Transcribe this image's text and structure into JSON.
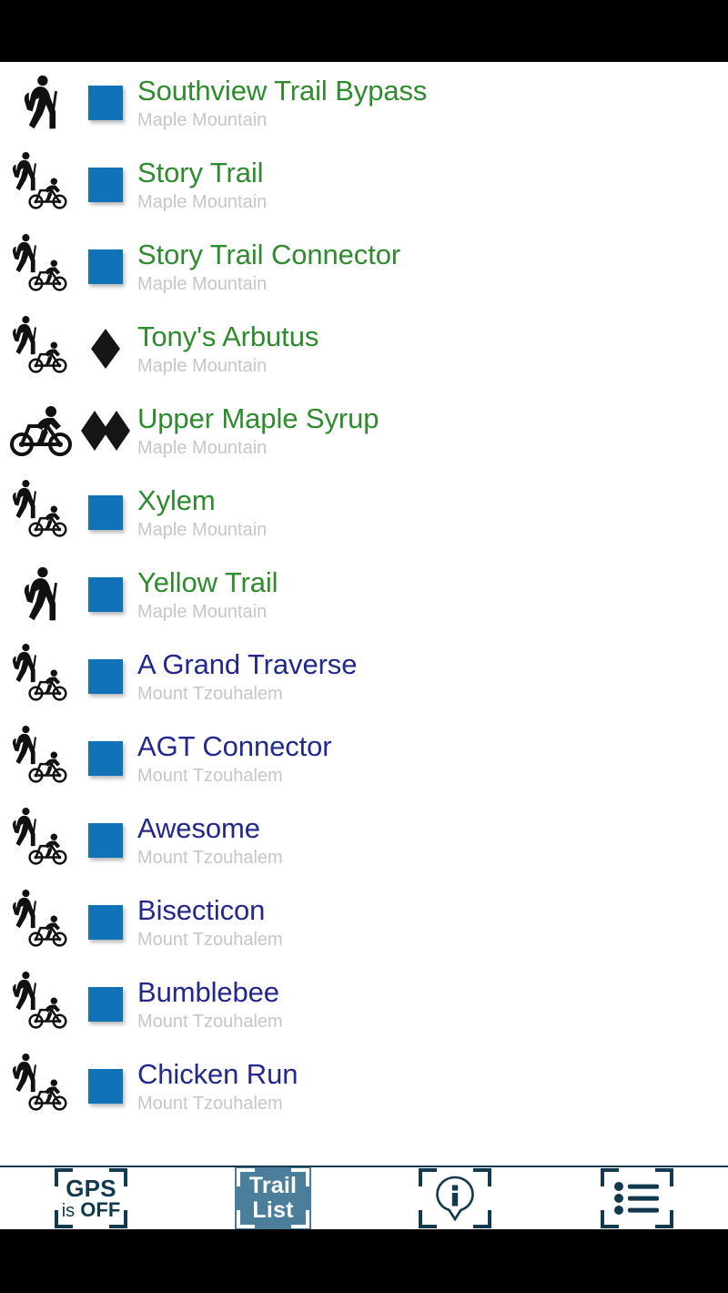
{
  "app": {
    "title": "Trail List"
  },
  "colors": {
    "title_green": "#2E8B2E",
    "title_navy": "#22288C",
    "area_gray": "#C3C7CB",
    "difficulty_blue": "#1272B8",
    "nav_selected_bg": "#4A7E9B",
    "nav_ink": "#12394E",
    "letterbox": "#000000"
  },
  "trails": [
    {
      "name": "Southview Trail Bypass",
      "area": "Maple Mountain",
      "color": "green",
      "use": "hiker",
      "difficulty": "blue-square"
    },
    {
      "name": "Story Trail",
      "area": "Maple Mountain",
      "color": "green",
      "use": "hiker-biker",
      "difficulty": "blue-square"
    },
    {
      "name": "Story Trail Connector",
      "area": "Maple Mountain",
      "color": "green",
      "use": "hiker-biker",
      "difficulty": "blue-square"
    },
    {
      "name": "Tony's Arbutus",
      "area": "Maple Mountain",
      "color": "green",
      "use": "hiker-biker",
      "difficulty": "black-diamond"
    },
    {
      "name": "Upper Maple Syrup",
      "area": "Maple Mountain",
      "color": "green",
      "use": "biker",
      "difficulty": "double-black-diamond"
    },
    {
      "name": "Xylem",
      "area": "Maple Mountain",
      "color": "green",
      "use": "hiker-biker",
      "difficulty": "blue-square"
    },
    {
      "name": "Yellow Trail",
      "area": "Maple Mountain",
      "color": "green",
      "use": "hiker",
      "difficulty": "blue-square"
    },
    {
      "name": "A Grand Traverse",
      "area": "Mount Tzouhalem",
      "color": "navy",
      "use": "hiker-biker",
      "difficulty": "blue-square"
    },
    {
      "name": "AGT Connector",
      "area": "Mount Tzouhalem",
      "color": "navy",
      "use": "hiker-biker",
      "difficulty": "blue-square"
    },
    {
      "name": "Awesome",
      "area": "Mount Tzouhalem",
      "color": "navy",
      "use": "hiker-biker",
      "difficulty": "blue-square"
    },
    {
      "name": "Bisecticon",
      "area": "Mount Tzouhalem",
      "color": "navy",
      "use": "hiker-biker",
      "difficulty": "blue-square"
    },
    {
      "name": "Bumblebee",
      "area": "Mount Tzouhalem",
      "color": "navy",
      "use": "hiker-biker",
      "difficulty": "blue-square"
    },
    {
      "name": "Chicken Run",
      "area": "Mount Tzouhalem",
      "color": "navy",
      "use": "hiker-biker",
      "difficulty": "blue-square"
    }
  ],
  "navbar": {
    "gps": {
      "line1": "GPS",
      "line2_prefix": "is",
      "line2_value": "OFF",
      "selected": false
    },
    "trail_list": {
      "line1": "Trail",
      "line2": "List",
      "selected": true
    },
    "info": {
      "icon": "info-pin-icon",
      "selected": false
    },
    "list": {
      "icon": "bulleted-list-icon",
      "selected": false
    }
  }
}
